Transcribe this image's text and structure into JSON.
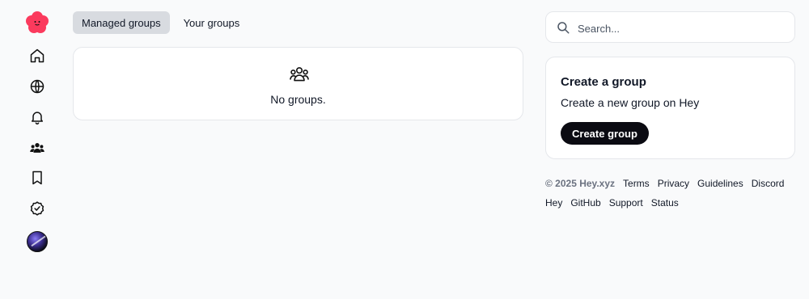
{
  "tabs": [
    {
      "label": "Managed groups",
      "active": true
    },
    {
      "label": "Your groups",
      "active": false
    }
  ],
  "main": {
    "empty_text": "No groups."
  },
  "search": {
    "placeholder": "Search..."
  },
  "create_group": {
    "title": "Create a group",
    "description": "Create a new group on Hey",
    "button_label": "Create group"
  },
  "footer": {
    "copyright": "© 2025 Hey.xyz",
    "links": [
      "Terms",
      "Privacy",
      "Guidelines",
      "Discord",
      "Hey",
      "GitHub",
      "Support",
      "Status"
    ]
  },
  "sidebar": {
    "icons": [
      "logo-icon",
      "home-icon",
      "globe-icon",
      "bell-icon",
      "groups-icon",
      "bookmark-icon",
      "verified-check-icon",
      "avatar"
    ]
  },
  "colors": {
    "brand": "#fb3a5d",
    "background": "#f9fafb",
    "button": "#0b0b12",
    "active_tab": "#d8dbe0"
  }
}
